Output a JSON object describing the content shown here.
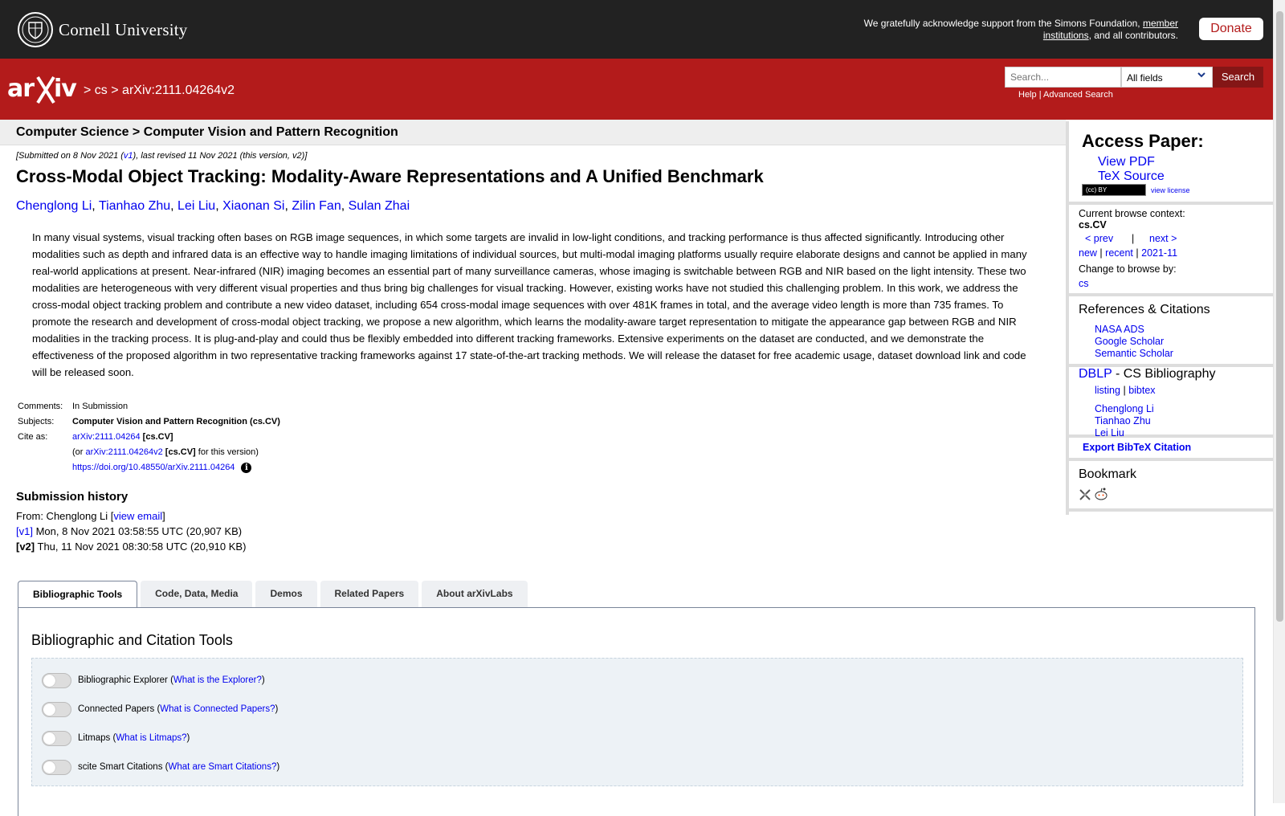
{
  "topbar": {
    "cornell_name": "Cornell University",
    "support_text": "We gratefully acknowledge support from the Simons Foundation,",
    "support_link": "member institutions",
    "support_tail": ", and all contributors.",
    "donate_label": "Donate"
  },
  "header": {
    "crumb_sep1": ">",
    "crumb_cs": "cs",
    "crumb_sep2": ">",
    "crumb_id": "arXiv:2111.04264v2",
    "search_placeholder": "Search...",
    "search_field": "All fields",
    "search_button": "Search",
    "help": "Help",
    "advanced": "Advanced Search",
    "help_sep": "|"
  },
  "subheader": "Computer Science > Computer Vision and Pattern Recognition",
  "paper": {
    "date_pre": "[Submitted on 8 Nov 2021 (",
    "date_v1": "v1",
    "date_post": "), last revised 11 Nov 2021 (this version, v2)]",
    "title": "Cross-Modal Object Tracking: Modality-Aware Representations and A Unified Benchmark",
    "authors": [
      "Chenglong Li",
      "Tianhao Zhu",
      "Lei Liu",
      "Xiaonan Si",
      "Zilin Fan",
      "Sulan Zhai"
    ],
    "author_sep": ", ",
    "abstract": "In many visual systems, visual tracking often bases on RGB image sequences, in which some targets are invalid in low-light conditions, and tracking performance is thus affected significantly. Introducing other modalities such as depth and infrared data is an effective way to handle imaging limitations of individual sources, but multi-modal imaging platforms usually require elaborate designs and cannot be applied in many real-world applications at present. Near-infrared (NIR) imaging becomes an essential part of many surveillance cameras, whose imaging is switchable between RGB and NIR based on the light intensity. These two modalities are heterogeneous with very different visual properties and thus bring big challenges for visual tracking. However, existing works have not studied this challenging problem. In this work, we address the cross-modal object tracking problem and contribute a new video dataset, including 654 cross-modal image sequences with over 481K frames in total, and the average video length is more than 735 frames. To promote the research and development of cross-modal object tracking, we propose a new algorithm, which learns the modality-aware target representation to mitigate the appearance gap between RGB and NIR modalities in the tracking process. It is plug-and-play and could thus be flexibly embedded into different tracking frameworks. Extensive experiments on the dataset are conducted, and we demonstrate the effectiveness of the proposed algorithm in two representative tracking frameworks against 17 state-of-the-art tracking methods. We will release the dataset for free academic usage, dataset download link and code will be released soon."
  },
  "meta": {
    "comments_label": "Comments:",
    "comments": "In Submission",
    "subjects_label": "Subjects:",
    "subjects": "Computer Vision and Pattern Recognition (cs.CV)",
    "cite_label": "Cite as:",
    "cite_id": "arXiv:2111.04264",
    "cite_cat": "[cs.CV]",
    "cite2_pre": "(or",
    "cite2_id": "arXiv:2111.04264v2",
    "cite2_cat": "[cs.CV]",
    "cite2_post": "for this version)",
    "doi": "https://doi.org/10.48550/arXiv.2111.04264",
    "info_icon": "i"
  },
  "history": {
    "heading": "Submission history",
    "from_pre": "From: Chenglong Li [",
    "from_link": "view email",
    "from_post": "]",
    "v1_tag": "[v1]",
    "v1_text": "Mon, 8 Nov 2021 03:58:55 UTC (20,907 KB)",
    "v2_tag": "[v2]",
    "v2_text": "Thu, 11 Nov 2021 08:30:58 UTC (20,910 KB)"
  },
  "tabs": [
    "Bibliographic Tools",
    "Code, Data, Media",
    "Demos",
    "Related Papers",
    "About arXivLabs"
  ],
  "panel": {
    "title": "Bibliographic and Citation Tools",
    "tools": [
      {
        "name": "Bibliographic Explorer",
        "link": "What is the Explorer?"
      },
      {
        "name": "Connected Papers",
        "link": "What is Connected Papers?"
      },
      {
        "name": "Litmaps",
        "link": "What is Litmaps?"
      },
      {
        "name": "scite Smart Citations",
        "link": "What are Smart Citations?"
      }
    ]
  },
  "sidebar": {
    "access_heading": "Access Paper:",
    "view_pdf": "View PDF",
    "tex_source": "TeX Source",
    "cc_badge": "(cc) BY",
    "view_license": "view license",
    "context_label": "Current browse context:",
    "context": "cs.CV",
    "prev": "< prev",
    "nav_sep": "|",
    "next": "next >",
    "new": "new",
    "recent": "recent",
    "month": "2021-11",
    "change_label": "Change to browse by:",
    "change_cs": "cs",
    "refs_heading": "References & Citations",
    "nasa": "NASA ADS",
    "google": "Google Scholar",
    "semantic": "Semantic Scholar",
    "dblp": "DBLP",
    "dblp_rest": " - CS Bibliography",
    "listing": "listing",
    "bibtex": "bibtex",
    "dblp_authors": [
      "Chenglong Li",
      "Tianhao Zhu",
      "Lei Liu"
    ],
    "export": "Export BibTeX Citation",
    "bookmark": "Bookmark"
  },
  "colors": {
    "brand_red": "#b31b1b",
    "dark_bar": "#222222",
    "link": "#0000ee"
  }
}
